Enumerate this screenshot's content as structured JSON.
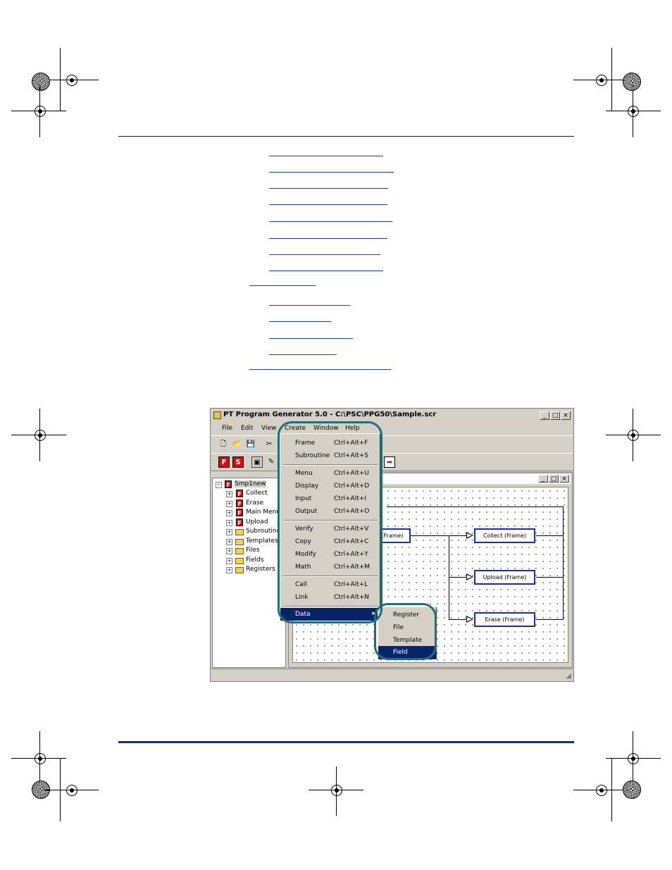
{
  "window": {
    "title": "PT Program Generator 5.0 - C:\\PSC\\PPG50\\Sample.scr",
    "controls": [
      "_",
      "□",
      "×"
    ],
    "menubar": [
      "File",
      "Edit",
      "View",
      "Create",
      "Window",
      "Help"
    ]
  },
  "tree": {
    "root": "Smp1new",
    "items": [
      {
        "label": "Collect",
        "icon": "frame-icon"
      },
      {
        "label": "Erase",
        "icon": "frame-icon"
      },
      {
        "label": "Main Menu",
        "icon": "frame-icon"
      },
      {
        "label": "Upload",
        "icon": "frame-icon"
      },
      {
        "label": "Subroutines",
        "icon": "folder-icon"
      },
      {
        "label": "Templates",
        "icon": "folder-icon"
      },
      {
        "label": "Files",
        "icon": "folder-icon"
      },
      {
        "label": "Fields",
        "icon": "folder-icon"
      },
      {
        "label": "Registers",
        "icon": "folder-icon"
      }
    ]
  },
  "create_menu": {
    "groups": [
      [
        {
          "label": "Frame",
          "shortcut": "Ctrl+Alt+F"
        },
        {
          "label": "Subroutine",
          "shortcut": "Ctrl+Alt+S"
        }
      ],
      [
        {
          "label": "Menu",
          "shortcut": "Ctrl+Alt+U"
        },
        {
          "label": "Display",
          "shortcut": "Ctrl+Alt+D"
        },
        {
          "label": "Input",
          "shortcut": "Ctrl+Alt+I"
        },
        {
          "label": "Output",
          "shortcut": "Ctrl+Alt+O"
        }
      ],
      [
        {
          "label": "Verify",
          "shortcut": "Ctrl+Alt+V"
        },
        {
          "label": "Copy",
          "shortcut": "Ctrl+Alt+C"
        },
        {
          "label": "Modify",
          "shortcut": "Ctrl+Alt+Y"
        },
        {
          "label": "Math",
          "shortcut": "Ctrl+Alt+M"
        }
      ],
      [
        {
          "label": "Call",
          "shortcut": "Ctrl+Alt+L"
        },
        {
          "label": "Link",
          "shortcut": "Ctrl+Alt+N"
        }
      ],
      [
        {
          "label": "Data",
          "shortcut": ""
        }
      ]
    ]
  },
  "data_submenu": [
    "Register",
    "File",
    "Template",
    "Field"
  ],
  "diagram": {
    "left_node": "(Frame)",
    "nodes": [
      "Collect (Frame)",
      "Upload (Frame)",
      "Erase (Frame)"
    ]
  },
  "colors": {
    "selection": "#0a246a",
    "node_border": "#1a2cc0",
    "highlight_ring": "#1f6f78",
    "rule": "#1d2a80"
  }
}
